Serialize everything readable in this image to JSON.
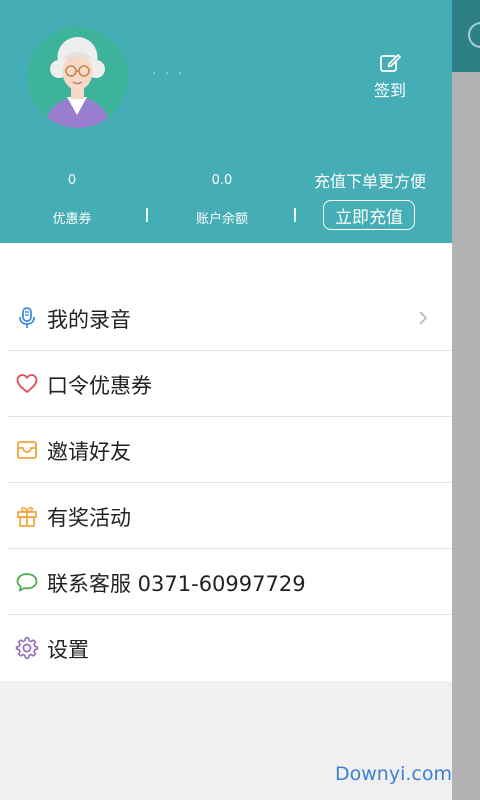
{
  "header": {
    "username": "· · ·",
    "checkin_label": "签到",
    "coupons": {
      "value": "0",
      "label": "优惠券"
    },
    "balance": {
      "value": "0.0",
      "label": "账户余额"
    },
    "promo_text": "充值下单更方便",
    "recharge_button": "立即充值"
  },
  "menu": {
    "items": [
      {
        "label": "我的录音",
        "icon": "microphone-icon"
      },
      {
        "label": "口令优惠券",
        "icon": "heart-icon"
      },
      {
        "label": "邀请好友",
        "icon": "invite-icon"
      },
      {
        "label": "有奖活动",
        "icon": "gift-icon"
      },
      {
        "label": "联系客服 0371-60997729",
        "icon": "chat-bubble-icon"
      },
      {
        "label": "设置",
        "icon": "gear-icon"
      }
    ]
  },
  "watermark": "Downyi.com",
  "colors": {
    "header_bg": "#44adb6",
    "mic": "#3d8de0",
    "heart": "#e0505a",
    "invite": "#f3a33a",
    "gift": "#f3a33a",
    "chat": "#4caf50",
    "gear": "#8e6bb8"
  }
}
